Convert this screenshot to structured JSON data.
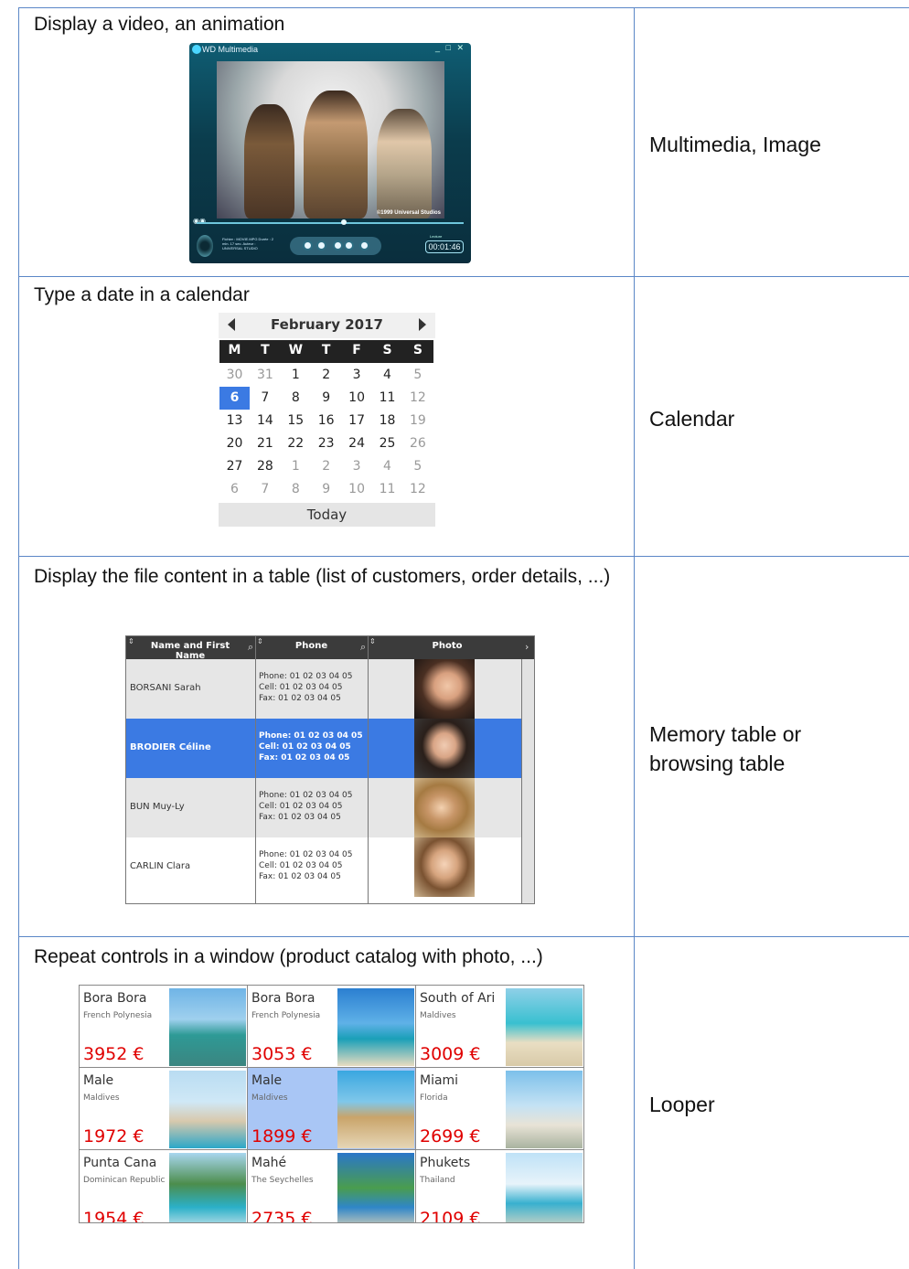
{
  "rows": [
    {
      "description": "Display a video, an animation",
      "label": "Multimedia, Image"
    },
    {
      "description": "Type a date in a calendar",
      "label": "Calendar"
    },
    {
      "description": "Display the file content in a table (list of customers, order details, ...)",
      "label": "Memory table or browsing table"
    },
    {
      "description": "Repeat controls in a window (product catalog with photo, ...)",
      "label": "Looper"
    }
  ],
  "player": {
    "title": "WD Multimedia",
    "copyright": "©1999 Universal Studios",
    "time": "00:01:46",
    "read_label": "Lecture",
    "info": "Fichier : MOVIE.MPG  Durée : 2 min. 17 sec.  Auteur : UNIVERSAL STUDIO"
  },
  "calendar": {
    "month": "February 2017",
    "weekdays": [
      "M",
      "T",
      "W",
      "T",
      "F",
      "S",
      "S"
    ],
    "weeks": [
      [
        "30",
        "31",
        "1",
        "2",
        "3",
        "4",
        "5"
      ],
      [
        "6",
        "7",
        "8",
        "9",
        "10",
        "11",
        "12"
      ],
      [
        "13",
        "14",
        "15",
        "16",
        "17",
        "18",
        "19"
      ],
      [
        "20",
        "21",
        "22",
        "23",
        "24",
        "25",
        "26"
      ],
      [
        "27",
        "28",
        "1",
        "2",
        "3",
        "4",
        "5"
      ],
      [
        "6",
        "7",
        "8",
        "9",
        "10",
        "11",
        "12"
      ]
    ],
    "selected": "6",
    "today_label": "Today"
  },
  "memory_table": {
    "columns": [
      "Name and First Name",
      "Phone",
      "Photo"
    ],
    "rows": [
      {
        "name": "BORSANI Sarah",
        "phone": "Phone: 01 02 03 04 05",
        "cell": "Cell: 01 02 03 04 05",
        "fax": "Fax: 01 02 03 04 05"
      },
      {
        "name": "BRODIER Céline",
        "phone": "Phone: 01 02 03 04 05",
        "cell": "Cell: 01 02 03 04 05",
        "fax": "Fax: 01 02 03 04 05"
      },
      {
        "name": "BUN Muy-Ly",
        "phone": "Phone: 01 02 03 04 05",
        "cell": "Cell: 01 02 03 04 05",
        "fax": "Fax: 01 02 03 04 05"
      },
      {
        "name": "CARLIN Clara",
        "phone": "Phone: 01 02 03 04 05",
        "cell": "Cell: 01 02 03 04 05",
        "fax": "Fax: 01 02 03 04 05"
      }
    ]
  },
  "looper": {
    "items": [
      {
        "title": "Bora Bora",
        "subtitle": "French Polynesia",
        "price": "3952 €"
      },
      {
        "title": "Bora Bora",
        "subtitle": "French Polynesia",
        "price": "3053 €"
      },
      {
        "title": "South of Ari",
        "subtitle": "Maldives",
        "price": "3009 €"
      },
      {
        "title": "Male",
        "subtitle": "Maldives",
        "price": "1972 €"
      },
      {
        "title": "Male",
        "subtitle": "Maldives",
        "price": "1899 €"
      },
      {
        "title": "Miami",
        "subtitle": "Florida",
        "price": "2699 €"
      },
      {
        "title": "Punta Cana",
        "subtitle": "Dominican Republic",
        "price": "1954 €"
      },
      {
        "title": "Mahé",
        "subtitle": "The Seychelles",
        "price": "2735 €"
      },
      {
        "title": "Phukets",
        "subtitle": "Thailand",
        "price": "2109 €"
      }
    ]
  },
  "colors": {
    "grid": "#5b87c7",
    "selection": "#3b7ae3",
    "price": "#e00000",
    "looper_selection": "#a9c6f5"
  }
}
